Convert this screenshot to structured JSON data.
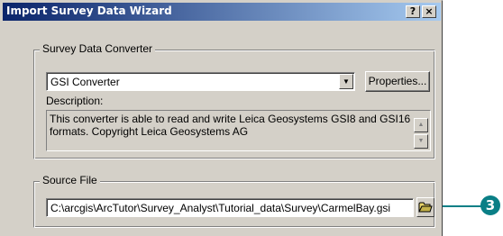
{
  "window": {
    "title": "Import Survey Data Wizard",
    "help_button": "?",
    "close_button": "×"
  },
  "converter_group": {
    "legend": "Survey Data Converter",
    "selected_converter": "GSI Converter",
    "properties_button": "Properties...",
    "description_label": "Description:",
    "description_text": "This converter is able to read and write Leica Geosystems GSI8 and GSI16 formats. Copyright Leica Geosystems AG"
  },
  "source_group": {
    "legend": "Source File",
    "path": "C:\\arcgis\\ArcTutor\\Survey_Analyst\\Tutorial_data\\Survey\\CarmelBay.gsi"
  },
  "callout": {
    "number": "3",
    "color": "#0a7f86"
  },
  "icons": {
    "dropdown": "chevron-down-icon",
    "browse": "open-folder-icon",
    "scroll_up": "scroll-up-icon",
    "scroll_down": "scroll-down-icon"
  }
}
